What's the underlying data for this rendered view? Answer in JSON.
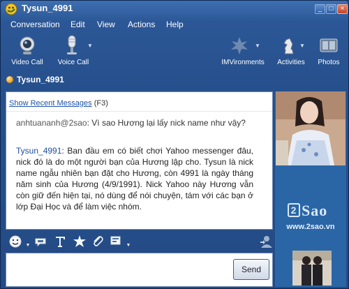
{
  "window": {
    "title": "Tysun_4991",
    "buttons": {
      "minimize": "_",
      "maximize": "□",
      "close": "×"
    }
  },
  "menu": [
    "Conversation",
    "Edit",
    "View",
    "Actions",
    "Help"
  ],
  "toolbar": {
    "video_call": "Video Call",
    "voice_call": "Voice Call",
    "imvironments": "IMVironments",
    "activities": "Activities",
    "photos": "Photos"
  },
  "contact": {
    "name": "Tysun_4991",
    "status_color": "#f0a020"
  },
  "conversation": {
    "recent_link": "Show Recent Messages",
    "recent_key": "(F3)",
    "messages": [
      {
        "sender": "anhtuananh@2sao",
        "text": ": Vì sao Hương lại lấy nick name như vậy?"
      },
      {
        "sender": "Tysun_4991",
        "text": ": Ban đầu em có biết chơi Yahoo messenger đâu, nick đó là do một người bạn của Hương lập cho. Tysun là nick name ngẫu nhiên bạn đặt cho Hương, còn 4991 là ngày tháng năm sinh của Hương (4/9/1991). Nick Yahoo này Hương vẫn còn giữ đến hiện tại, nó dùng để nói chuyện, tám với các bạn ở lớp Đại Học và để làm việc nhóm."
      }
    ]
  },
  "format_toolbar": [
    "emoticon-icon",
    "audible-icon",
    "text-format-icon",
    "nudge-icon",
    "attach-icon",
    "insert-icon"
  ],
  "send_label": "Send",
  "sidebar": {
    "logo_number": "2",
    "logo_text": "Sao",
    "url": "www.2sao.vn"
  },
  "colors": {
    "accent": "#2c5796",
    "link": "#1d54a8",
    "sender": "#1d4f9e"
  }
}
